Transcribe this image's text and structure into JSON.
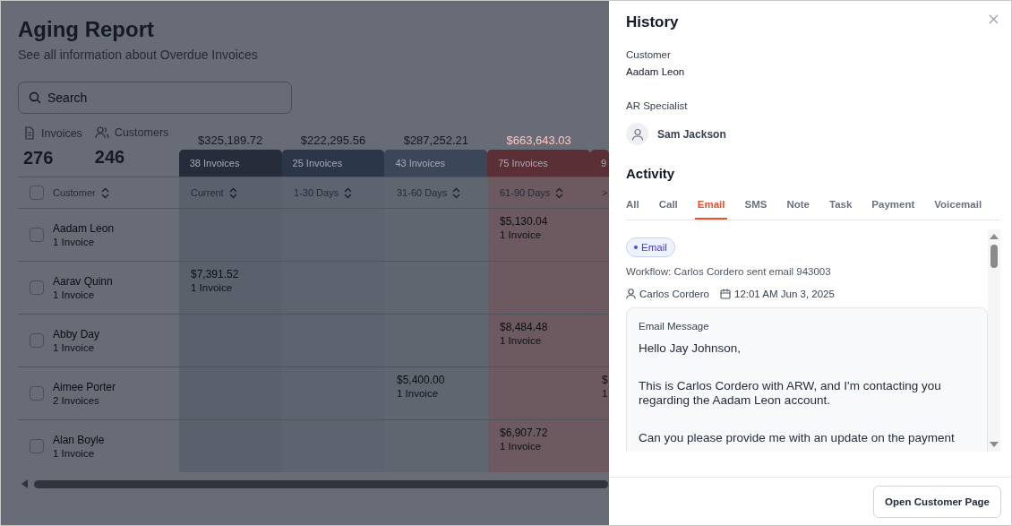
{
  "report": {
    "title": "Aging Report",
    "subtitle": "See all information about Overdue Invoices",
    "search": {
      "placeholder": "Search"
    },
    "stats": [
      {
        "kind": "invoices",
        "label": "Invoices",
        "value": "276"
      },
      {
        "kind": "customers",
        "label": "Customers",
        "value": "246"
      }
    ],
    "table": {
      "customer_column": "Customer",
      "header_checked": false,
      "buckets": [
        {
          "amount": "$325,189.72",
          "count": "38 Invoices",
          "label": "Current",
          "color": "#262c3a"
        },
        {
          "amount": "$222,295.56",
          "count": "25 Invoices",
          "label": "1-30 Days",
          "color": "#2b3749"
        },
        {
          "amount": "$287,252.21",
          "count": "43 Invoices",
          "label": "31-60 Days",
          "color": "#3b4758"
        },
        {
          "amount": "$663,643.03",
          "count": "75 Invoices",
          "label": "61-90 Days",
          "color": "#5a2f35"
        },
        {
          "count": "9",
          "label": ">",
          "color": "#5a2f35"
        }
      ],
      "rows": [
        {
          "name": "Aadam Leon",
          "invoices": "1 Invoice",
          "checked": false,
          "days_61_90": {
            "amount": "$5,130.04",
            "count": "1 Invoice"
          }
        },
        {
          "name": "Aarav Quinn",
          "invoices": "1 Invoice",
          "checked": false,
          "current": {
            "amount": "$7,391.52",
            "count": "1 Invoice"
          }
        },
        {
          "name": "Abby Day",
          "invoices": "1 Invoice",
          "checked": false,
          "days_61_90": {
            "amount": "$8,484.48",
            "count": "1 Invoice"
          }
        },
        {
          "name": "Aimee Porter",
          "invoices": "2 Invoices",
          "checked": false,
          "days_31_60": {
            "amount": "$5,400.00",
            "count": "1 Invoice"
          },
          "column_6": {
            "amount": "$",
            "count": "1"
          }
        },
        {
          "name": "Alan Boyle",
          "invoices": "1 Invoice",
          "checked": false,
          "days_61_90": {
            "amount": "$6,907.72",
            "count": "1 Invoice"
          }
        }
      ]
    }
  },
  "panel": {
    "title": "History",
    "customer_label": "Customer",
    "customer": "Aadam Leon",
    "specialist_label": "AR Specialist",
    "specialist": "Sam Jackson",
    "activity_title": "Activity",
    "tabs": [
      {
        "label": "All",
        "selected": false
      },
      {
        "label": "Call",
        "selected": false
      },
      {
        "label": "Email",
        "selected": true
      },
      {
        "label": "SMS",
        "selected": false
      },
      {
        "label": "Note",
        "selected": false
      },
      {
        "label": "Task",
        "selected": false
      },
      {
        "label": "Payment",
        "selected": false
      },
      {
        "label": "Voicemail",
        "selected": false
      }
    ],
    "entry": {
      "tag": "Email",
      "description": "Workflow: Carlos Cordero sent email 943003",
      "author": "Carlos Cordero",
      "datetime": "12:01 AM Jun 3, 2025",
      "message_label": "Email Message",
      "paragraphs": [
        "Hello Jay Johnson,",
        "This is Carlos Cordero with ARW, and I'm contacting you regarding the Aadam Leon account.",
        "Can you please provide me with an update on the payment"
      ]
    },
    "footer_button": "Open Customer Page"
  }
}
